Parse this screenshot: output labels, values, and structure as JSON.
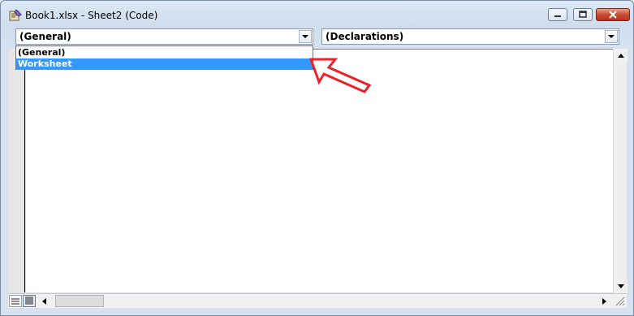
{
  "window": {
    "title": "Book1.xlsx - Sheet2 (Code)"
  },
  "controls": {
    "minimize_icon": "minimize-icon",
    "maximize_icon": "restore-icon",
    "close_icon": "close-icon"
  },
  "object_combo": {
    "value": "(General)"
  },
  "procedure_combo": {
    "value": "(Declarations)"
  },
  "object_dropdown": {
    "items": [
      {
        "label": "(General)",
        "selected": false
      },
      {
        "label": "Worksheet",
        "selected": true
      }
    ]
  },
  "colors": {
    "selection": "#3399ff",
    "annotation_arrow": "#e8232a"
  }
}
